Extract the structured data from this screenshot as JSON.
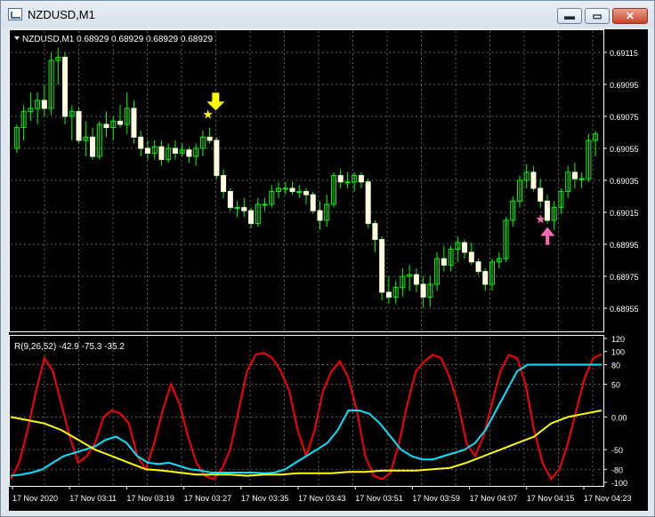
{
  "window": {
    "title": "NZDUSD,M1",
    "buttons": {
      "minimize": "▬",
      "maximize": "▭",
      "close": "✕"
    }
  },
  "main_chart": {
    "info_label": "NZDUSD,M1  0.68929 0.68929 0.68929 0.68929",
    "price_labels": [
      "0.69115",
      "0.69095",
      "0.69075",
      "0.69055",
      "0.69035",
      "0.69015",
      "0.68995",
      "0.68975",
      "0.68955"
    ],
    "colors": {
      "background": "#000000",
      "grid": "#5f5f5f",
      "candle_up": "#ffffe0",
      "candle_down": "#ffffe0",
      "wick": "#00ff00",
      "text": "#ffffff"
    },
    "markers": {
      "sell_arrow_color": "#ffff00",
      "buy_arrow_color": "#ff69b4"
    }
  },
  "indicator": {
    "info_label": "R(9,26,52) -42.9 -75.3 -35.2",
    "scale_labels": [
      "120",
      "100",
      "80",
      "50",
      "0.00",
      "-50",
      "-80",
      "-100"
    ],
    "line_colors": [
      "#ff0000",
      "#00e5ff",
      "#ffff00"
    ]
  },
  "time_axis": {
    "labels": [
      "17 Nov 2020",
      "17 Nov 03:11",
      "17 Nov 03:19",
      "17 Nov 03:27",
      "17 Nov 03:35",
      "17 Nov 03:43",
      "17 Nov 03:51",
      "17 Nov 03:59",
      "17 Nov 04:07",
      "17 Nov 04:15",
      "17 Nov 04:23"
    ]
  },
  "chart_data": [
    {
      "type": "candlestick",
      "title": "NZDUSD,M1",
      "ylim": [
        0.68945,
        0.69125
      ],
      "candles": [
        {
          "o": 0.69055,
          "h": 0.6907,
          "l": 0.69052,
          "c": 0.69068
        },
        {
          "o": 0.69068,
          "h": 0.69082,
          "l": 0.6906,
          "c": 0.69078
        },
        {
          "o": 0.69078,
          "h": 0.6909,
          "l": 0.69072,
          "c": 0.6908
        },
        {
          "o": 0.6908,
          "h": 0.6909,
          "l": 0.6907,
          "c": 0.69085
        },
        {
          "o": 0.69085,
          "h": 0.69095,
          "l": 0.69075,
          "c": 0.6908
        },
        {
          "o": 0.6908,
          "h": 0.69115,
          "l": 0.69076,
          "c": 0.6911
        },
        {
          "o": 0.6911,
          "h": 0.69118,
          "l": 0.69095,
          "c": 0.69112
        },
        {
          "o": 0.69112,
          "h": 0.69115,
          "l": 0.6907,
          "c": 0.69075
        },
        {
          "o": 0.69075,
          "h": 0.69082,
          "l": 0.6906,
          "c": 0.69078
        },
        {
          "o": 0.69078,
          "h": 0.6908,
          "l": 0.69058,
          "c": 0.6906
        },
        {
          "o": 0.6906,
          "h": 0.69072,
          "l": 0.6905,
          "c": 0.69062
        },
        {
          "o": 0.69062,
          "h": 0.69068,
          "l": 0.69048,
          "c": 0.6905
        },
        {
          "o": 0.6905,
          "h": 0.69072,
          "l": 0.69048,
          "c": 0.6907
        },
        {
          "o": 0.6907,
          "h": 0.69078,
          "l": 0.69062,
          "c": 0.69068
        },
        {
          "o": 0.69068,
          "h": 0.69075,
          "l": 0.6906,
          "c": 0.69072
        },
        {
          "o": 0.69072,
          "h": 0.69082,
          "l": 0.69068,
          "c": 0.6907
        },
        {
          "o": 0.6907,
          "h": 0.6909,
          "l": 0.69064,
          "c": 0.6908
        },
        {
          "o": 0.6908,
          "h": 0.69085,
          "l": 0.69058,
          "c": 0.69062
        },
        {
          "o": 0.69062,
          "h": 0.69066,
          "l": 0.6905,
          "c": 0.69055
        },
        {
          "o": 0.69055,
          "h": 0.6906,
          "l": 0.69048,
          "c": 0.69052
        },
        {
          "o": 0.69052,
          "h": 0.6906,
          "l": 0.69048,
          "c": 0.69056
        },
        {
          "o": 0.69056,
          "h": 0.6906,
          "l": 0.69044,
          "c": 0.69048
        },
        {
          "o": 0.69048,
          "h": 0.69058,
          "l": 0.69046,
          "c": 0.69055
        },
        {
          "o": 0.69055,
          "h": 0.6906,
          "l": 0.69048,
          "c": 0.69052
        },
        {
          "o": 0.69052,
          "h": 0.69058,
          "l": 0.6905,
          "c": 0.69054
        },
        {
          "o": 0.69054,
          "h": 0.69056,
          "l": 0.69046,
          "c": 0.6905
        },
        {
          "o": 0.6905,
          "h": 0.69058,
          "l": 0.69044,
          "c": 0.69055
        },
        {
          "o": 0.69055,
          "h": 0.69066,
          "l": 0.6905,
          "c": 0.69062
        },
        {
          "o": 0.69062,
          "h": 0.69068,
          "l": 0.69058,
          "c": 0.6906
        },
        {
          "o": 0.6906,
          "h": 0.69062,
          "l": 0.69036,
          "c": 0.69038
        },
        {
          "o": 0.69038,
          "h": 0.69042,
          "l": 0.69024,
          "c": 0.69028
        },
        {
          "o": 0.69028,
          "h": 0.6903,
          "l": 0.69016,
          "c": 0.69018
        },
        {
          "o": 0.69018,
          "h": 0.69022,
          "l": 0.69012,
          "c": 0.69018
        },
        {
          "o": 0.69018,
          "h": 0.69024,
          "l": 0.69012,
          "c": 0.69016
        },
        {
          "o": 0.69016,
          "h": 0.69018,
          "l": 0.69005,
          "c": 0.69008
        },
        {
          "o": 0.69008,
          "h": 0.69024,
          "l": 0.69006,
          "c": 0.6902
        },
        {
          "o": 0.6902,
          "h": 0.69024,
          "l": 0.69016,
          "c": 0.6902
        },
        {
          "o": 0.6902,
          "h": 0.69032,
          "l": 0.69018,
          "c": 0.69028
        },
        {
          "o": 0.69028,
          "h": 0.69034,
          "l": 0.69024,
          "c": 0.6903
        },
        {
          "o": 0.6903,
          "h": 0.69034,
          "l": 0.69026,
          "c": 0.6903
        },
        {
          "o": 0.6903,
          "h": 0.69034,
          "l": 0.69026,
          "c": 0.69028
        },
        {
          "o": 0.69028,
          "h": 0.69032,
          "l": 0.69024,
          "c": 0.69028
        },
        {
          "o": 0.69028,
          "h": 0.6903,
          "l": 0.6902,
          "c": 0.69026
        },
        {
          "o": 0.69026,
          "h": 0.69028,
          "l": 0.69014,
          "c": 0.69016
        },
        {
          "o": 0.69016,
          "h": 0.69022,
          "l": 0.69004,
          "c": 0.6901
        },
        {
          "o": 0.6901,
          "h": 0.69026,
          "l": 0.69006,
          "c": 0.6902
        },
        {
          "o": 0.6902,
          "h": 0.6904,
          "l": 0.69018,
          "c": 0.69038
        },
        {
          "o": 0.69038,
          "h": 0.69042,
          "l": 0.6903,
          "c": 0.69034
        },
        {
          "o": 0.69034,
          "h": 0.6904,
          "l": 0.6903,
          "c": 0.69034
        },
        {
          "o": 0.69034,
          "h": 0.6904,
          "l": 0.69028,
          "c": 0.69038
        },
        {
          "o": 0.69038,
          "h": 0.6904,
          "l": 0.6903,
          "c": 0.69034
        },
        {
          "o": 0.69034,
          "h": 0.69036,
          "l": 0.69005,
          "c": 0.69008
        },
        {
          "o": 0.69008,
          "h": 0.6901,
          "l": 0.6899,
          "c": 0.68998
        },
        {
          "o": 0.68998,
          "h": 0.69,
          "l": 0.6896,
          "c": 0.68965
        },
        {
          "o": 0.68965,
          "h": 0.68975,
          "l": 0.68958,
          "c": 0.68962
        },
        {
          "o": 0.68962,
          "h": 0.68972,
          "l": 0.68958,
          "c": 0.68968
        },
        {
          "o": 0.68968,
          "h": 0.6898,
          "l": 0.68962,
          "c": 0.68975
        },
        {
          "o": 0.68975,
          "h": 0.68982,
          "l": 0.68966,
          "c": 0.68976
        },
        {
          "o": 0.68976,
          "h": 0.6898,
          "l": 0.68965,
          "c": 0.6897
        },
        {
          "o": 0.6897,
          "h": 0.68975,
          "l": 0.68955,
          "c": 0.68962
        },
        {
          "o": 0.68962,
          "h": 0.68975,
          "l": 0.68956,
          "c": 0.6897
        },
        {
          "o": 0.6897,
          "h": 0.6899,
          "l": 0.68966,
          "c": 0.68986
        },
        {
          "o": 0.68986,
          "h": 0.68994,
          "l": 0.68978,
          "c": 0.68982
        },
        {
          "o": 0.68982,
          "h": 0.68994,
          "l": 0.68978,
          "c": 0.68992
        },
        {
          "o": 0.68992,
          "h": 0.69,
          "l": 0.68984,
          "c": 0.68996
        },
        {
          "o": 0.68996,
          "h": 0.68998,
          "l": 0.68986,
          "c": 0.6899
        },
        {
          "o": 0.6899,
          "h": 0.68996,
          "l": 0.68982,
          "c": 0.68984
        },
        {
          "o": 0.68984,
          "h": 0.68986,
          "l": 0.68976,
          "c": 0.68978
        },
        {
          "o": 0.68978,
          "h": 0.6898,
          "l": 0.68966,
          "c": 0.6897
        },
        {
          "o": 0.6897,
          "h": 0.68986,
          "l": 0.68966,
          "c": 0.68984
        },
        {
          "o": 0.68984,
          "h": 0.6899,
          "l": 0.6898,
          "c": 0.68986
        },
        {
          "o": 0.68986,
          "h": 0.69012,
          "l": 0.68984,
          "c": 0.6901
        },
        {
          "o": 0.6901,
          "h": 0.69025,
          "l": 0.69006,
          "c": 0.69022
        },
        {
          "o": 0.69022,
          "h": 0.69038,
          "l": 0.69018,
          "c": 0.69035
        },
        {
          "o": 0.69035,
          "h": 0.69045,
          "l": 0.6903,
          "c": 0.6904
        },
        {
          "o": 0.6904,
          "h": 0.69044,
          "l": 0.69028,
          "c": 0.6903
        },
        {
          "o": 0.6903,
          "h": 0.69036,
          "l": 0.69018,
          "c": 0.69022
        },
        {
          "o": 0.69022,
          "h": 0.69026,
          "l": 0.69008,
          "c": 0.6901
        },
        {
          "o": 0.6901,
          "h": 0.69022,
          "l": 0.69004,
          "c": 0.69018
        },
        {
          "o": 0.69018,
          "h": 0.6903,
          "l": 0.69014,
          "c": 0.69028
        },
        {
          "o": 0.69028,
          "h": 0.69044,
          "l": 0.69024,
          "c": 0.6904
        },
        {
          "o": 0.6904,
          "h": 0.69046,
          "l": 0.6903,
          "c": 0.69036
        },
        {
          "o": 0.69036,
          "h": 0.6904,
          "l": 0.6903,
          "c": 0.69036
        },
        {
          "o": 0.69036,
          "h": 0.69064,
          "l": 0.69034,
          "c": 0.6906
        },
        {
          "o": 0.6906,
          "h": 0.69066,
          "l": 0.6905,
          "c": 0.69064
        }
      ],
      "signals": [
        {
          "type": "sell",
          "index": 29
        },
        {
          "type": "buy",
          "index": 76
        }
      ]
    },
    {
      "type": "line",
      "title": "R(9,26,52)",
      "ylim": [
        -100,
        120
      ],
      "series": [
        {
          "name": "R(9)",
          "color": "#ff0000",
          "values": [
            -95,
            -70,
            -20,
            40,
            90,
            70,
            20,
            -30,
            -70,
            -60,
            -40,
            0,
            10,
            5,
            -10,
            -60,
            -80,
            -40,
            10,
            50,
            20,
            -30,
            -70,
            -90,
            -95,
            -80,
            -50,
            10,
            70,
            95,
            98,
            90,
            70,
            40,
            -20,
            -60,
            -20,
            40,
            70,
            85,
            60,
            10,
            -60,
            -90,
            -95,
            -85,
            -40,
            20,
            70,
            85,
            95,
            90,
            60,
            20,
            -40,
            -60,
            -30,
            20,
            70,
            95,
            90,
            50,
            -20,
            -70,
            -95,
            -80,
            -40,
            10,
            60,
            90,
            96
          ]
        },
        {
          "name": "R(26)",
          "color": "#00e5ff",
          "values": [
            -90,
            -88,
            -85,
            -80,
            -70,
            -60,
            -55,
            -50,
            -45,
            -35,
            -30,
            -40,
            -60,
            -70,
            -72,
            -70,
            -75,
            -80,
            -82,
            -85,
            -85,
            -85,
            -85,
            -85,
            -86,
            -85,
            -80,
            -70,
            -60,
            -50,
            -40,
            -20,
            10,
            10,
            5,
            -10,
            -30,
            -50,
            -60,
            -65,
            -65,
            -60,
            -55,
            -50,
            -40,
            -20,
            10,
            40,
            70,
            80,
            80,
            80,
            80,
            80,
            80,
            80,
            80
          ]
        },
        {
          "name": "R(52)",
          "color": "#ffff00",
          "values": [
            0,
            -5,
            -10,
            -20,
            -35,
            -50,
            -60,
            -70,
            -80,
            -82,
            -85,
            -88,
            -88,
            -88,
            -90,
            -88,
            -88,
            -86,
            -86,
            -86,
            -84,
            -84,
            -82,
            -82,
            -82,
            -80,
            -78,
            -70,
            -60,
            -50,
            -40,
            -30,
            -10,
            0,
            5,
            10
          ]
        }
      ]
    }
  ]
}
